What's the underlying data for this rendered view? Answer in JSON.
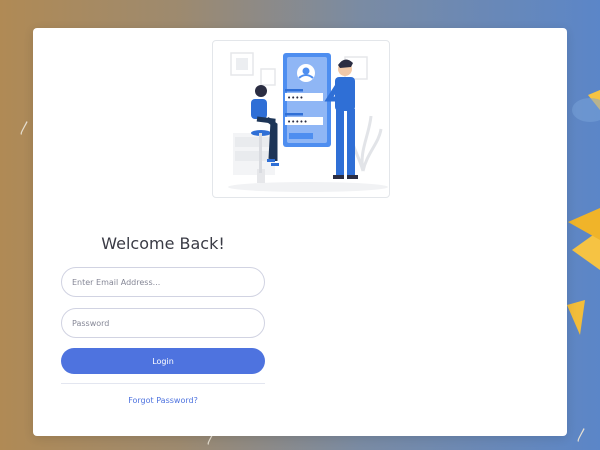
{
  "login": {
    "title": "Welcome Back!",
    "email_placeholder": "Enter Email Address...",
    "password_placeholder": "Password",
    "login_label": "Login",
    "forgot_label": "Forgot Password?"
  },
  "illustration": {
    "password_dots_1": "••••",
    "password_dots_2": "•••••",
    "accent_color": "#4e8ef0",
    "figure_color": "#2f6fd6"
  },
  "colors": {
    "primary": "#4e73df",
    "card_bg": "#ffffff",
    "title_text": "#3a3b45"
  }
}
